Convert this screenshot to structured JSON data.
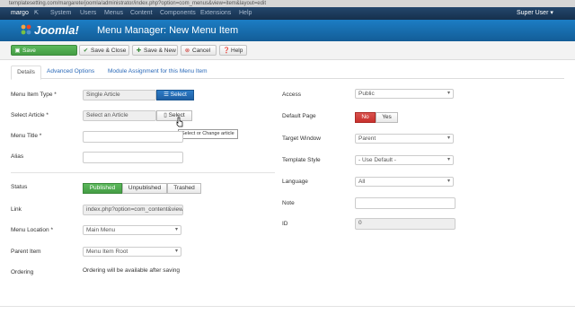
{
  "browser": {
    "url": "templatesetting.com/margarete/joomla/administrator/index.php?option=com_menus&view=item&layout=edit"
  },
  "topnav": {
    "site_name": "margo",
    "items": [
      "System",
      "Users",
      "Menus",
      "Content",
      "Components",
      "Extensions",
      "Help"
    ],
    "user": "Super User"
  },
  "header": {
    "logo_text": "Joomla!",
    "title": "Menu Manager: New Menu Item",
    "brand_color": "#1a6fb0"
  },
  "toolbar": {
    "save": "Save",
    "save_close": "Save & Close",
    "save_new": "Save & New",
    "cancel": "Cancel",
    "help": "Help"
  },
  "tabs": [
    "Details",
    "Advanced Options",
    "Module Assignment for this Menu Item"
  ],
  "form_left": {
    "menu_item_type": {
      "label": "Menu Item Type *",
      "value": "Single Article",
      "button": "Select"
    },
    "select_article": {
      "label": "Select Article *",
      "placeholder": "Select an Article",
      "button": "Select"
    },
    "menu_title": {
      "label": "Menu Title *",
      "value": ""
    },
    "alias": {
      "label": "Alias",
      "value": ""
    },
    "status": {
      "label": "Status",
      "options": [
        "Published",
        "Unpublished",
        "Trashed"
      ],
      "selected": "Published"
    },
    "link": {
      "label": "Link",
      "value": "index.php?option=com_content&view"
    },
    "menu_location": {
      "label": "Menu Location *",
      "value": "Main Menu"
    },
    "parent_item": {
      "label": "Parent Item",
      "value": "Menu Item Root"
    },
    "ordering": {
      "label": "Ordering",
      "value": "Ordering will be available after saving"
    }
  },
  "tooltip": "Select or Change article",
  "form_right": {
    "access": {
      "label": "Access",
      "value": "Public"
    },
    "default_page": {
      "label": "Default Page",
      "options": [
        "No",
        "Yes"
      ],
      "selected": "No"
    },
    "target_window": {
      "label": "Target Window",
      "value": "Parent"
    },
    "template_style": {
      "label": "Template Style",
      "value": "- Use Default -"
    },
    "language": {
      "label": "Language",
      "value": "All"
    },
    "note": {
      "label": "Note",
      "value": ""
    },
    "id": {
      "label": "ID",
      "value": "0"
    }
  },
  "icons": {
    "save": "floppy-icon",
    "save_close": "check-icon",
    "save_new": "plus-icon",
    "cancel": "cancel-icon",
    "help": "help-icon",
    "select_type": "list-icon",
    "select_article": "file-icon"
  }
}
